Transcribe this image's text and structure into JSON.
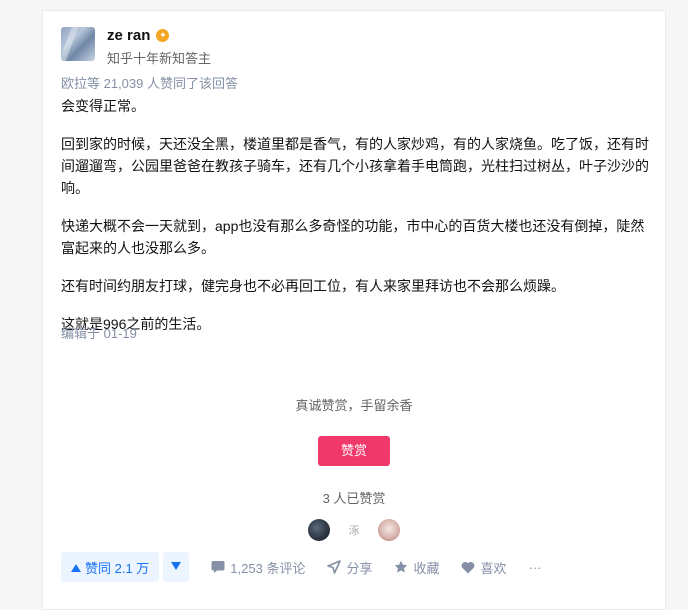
{
  "author": {
    "name": "ze ran",
    "headline": "知乎十年新知答主",
    "badge_icon": "badge-icon"
  },
  "votes_meta": "欧拉等 21,039 人赞同了该回答",
  "content": {
    "paragraphs": [
      "会变得正常。",
      "回到家的时候，天还没全黑，楼道里都是香气，有的人家炒鸡，有的人家烧鱼。吃了饭，还有时间遛遛弯，公园里爸爸在教孩子骑车，还有几个小孩拿着手电筒跑，光柱扫过树丛，叶子沙沙的响。",
      "快递大概不会一天就到，app也没有那么多奇怪的功能，市中心的百货大楼也还没有倒掉，陡然富起来的人也没那么多。",
      "还有时间约朋友打球，健完身也不必再回工位，有人来家里拜访也不会那么烦躁。",
      "这就是996之前的生活。"
    ],
    "edit_time": "编辑于 01-19"
  },
  "reward": {
    "slogan": "真诚赞赏，手留余香",
    "button_label": "赞赏",
    "count_text": "3 人已赞赏",
    "avatar2_text": "涿"
  },
  "actions": {
    "vote_up_label": "赞同 2.1 万",
    "comment_label": "1,253 条评论",
    "share_label": "分享",
    "favorite_label": "收藏",
    "like_label": "喜欢",
    "more_label": "···"
  },
  "colors": {
    "accent_blue": "#1772f6",
    "vote_bg": "#ebf4ff",
    "reward_pink": "#f1386a",
    "meta_gray": "#8590a6",
    "badge_orange": "#f5a623"
  }
}
